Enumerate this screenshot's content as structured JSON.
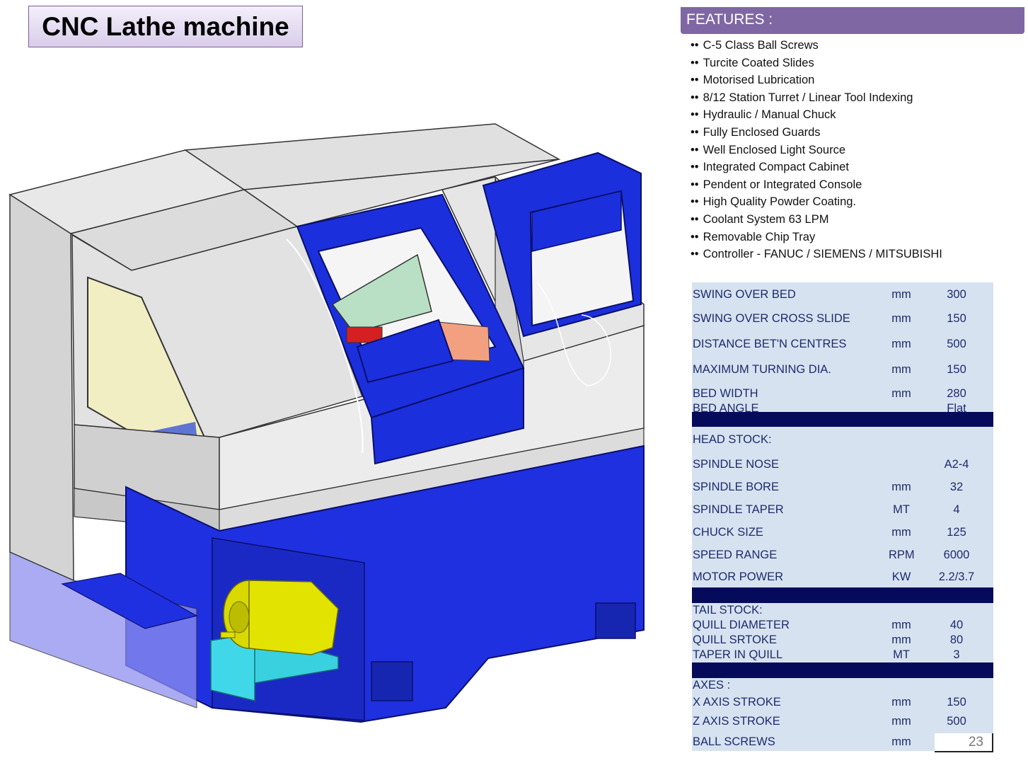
{
  "title": "CNC Lathe machine",
  "features": {
    "header": "FEATURES :",
    "bullet": "••",
    "items": [
      "C-5 Class Ball Screws",
      "Turcite Coated Slides",
      "Motorised Lubrication",
      "8/12 Station Turret / Linear Tool Indexing",
      "Hydraulic / Manual Chuck",
      "Fully Enclosed Guards",
      "Well Enclosed Light Source",
      "Integrated Compact Cabinet",
      "Pendent or Integrated Console",
      "High Quality Powder Coating.",
      "Coolant System 63 LPM",
      "Removable Chip Tray",
      "Controller - FANUC / SIEMENS / MITSUBISHI"
    ]
  },
  "specs": [
    {
      "label": "SWING OVER BED",
      "unit": "mm",
      "value": "300"
    },
    {
      "label": "SWING OVER CROSS SLIDE",
      "unit": "mm",
      "value": "150"
    },
    {
      "label": "DISTANCE BET'N CENTRES",
      "unit": "mm",
      "value": "500"
    },
    {
      "label": "MAXIMUM TURNING DIA.",
      "unit": "mm",
      "value": "150"
    },
    {
      "label": "BED WIDTH",
      "unit": "mm",
      "value": "280"
    },
    {
      "label": "BED ANGLE",
      "unit": "",
      "value": "Flat"
    },
    {
      "label": "HEAD STOCK:",
      "unit": "",
      "value": ""
    },
    {
      "label": "SPINDLE NOSE",
      "unit": "",
      "value": "A2-4"
    },
    {
      "label": "SPINDLE BORE",
      "unit": "mm",
      "value": "32"
    },
    {
      "label": "SPINDLE TAPER",
      "unit": "MT",
      "value": "4"
    },
    {
      "label": "CHUCK SIZE",
      "unit": "mm",
      "value": "125"
    },
    {
      "label": "SPEED RANGE",
      "unit": "RPM",
      "value": "6000"
    },
    {
      "label": "MOTOR POWER",
      "unit": "KW",
      "value": "2.2/3.7"
    },
    {
      "label": "TAIL STOCK:",
      "unit": "",
      "value": ""
    },
    {
      "label": "QUILL DIAMETER",
      "unit": "mm",
      "value": "40"
    },
    {
      "label": "QUILL SRTOKE",
      "unit": "mm",
      "value": "80"
    },
    {
      "label": "TAPER IN QUILL",
      "unit": "MT",
      "value": "3"
    },
    {
      "label": "AXES :",
      "unit": "",
      "value": ""
    },
    {
      "label": "X AXIS STROKE",
      "unit": "mm",
      "value": "150"
    },
    {
      "label": "Z AXIS STROKE",
      "unit": "mm",
      "value": "500"
    },
    {
      "label": "BALL SCREWS",
      "unit": "mm",
      "value": ""
    }
  ],
  "page_number": "23",
  "colors": {
    "accent_purple": "#7f67a3",
    "spec_text": "#1c2b6e",
    "spec_bg": "#d7e2f0",
    "band_navy": "#050b5a",
    "machine_blue": "#1f30e0"
  }
}
